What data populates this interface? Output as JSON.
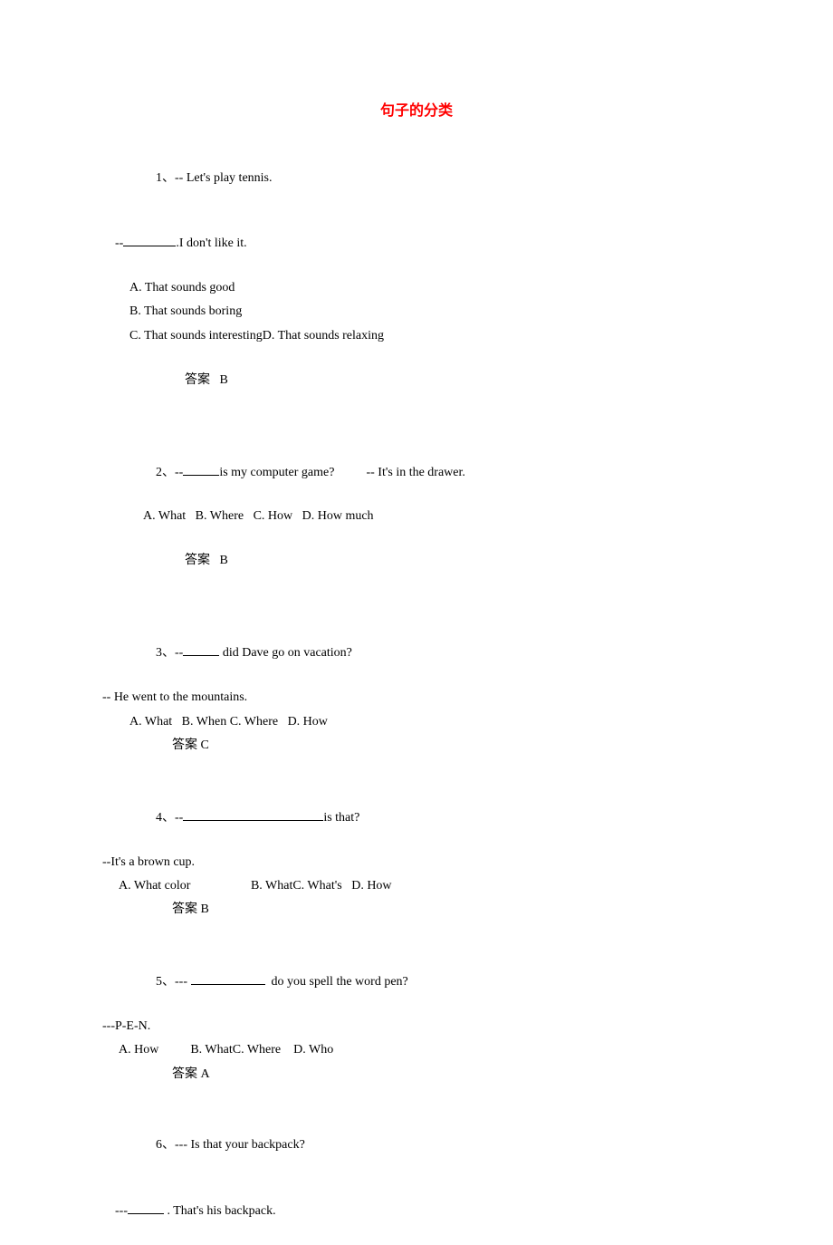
{
  "title": "句子的分类",
  "answer_label": "答案",
  "q1": {
    "num": "1、",
    "prompt": "-- Let's play tennis.",
    "line2_pre": "--",
    "line2_post": ".I don't like it.",
    "optA": "A. That sounds good",
    "optB": "B. That sounds boring",
    "optCD": "C. That sounds interestingD. That sounds relaxing",
    "answer": "B"
  },
  "q2": {
    "num": "2、",
    "line1_pre": "--",
    "line1_mid": "is my computer game?",
    "line1_right": "-- It's in the drawer.",
    "opts": "A. What   B. Where   C. How   D. How much",
    "answer": "B"
  },
  "q3": {
    "num": "3、",
    "line1_pre": "--",
    "line1_post": " did Dave go on vacation?",
    "line2": "-- He went to the mountains.",
    "opts": "A. What   B. When C. Where   D. How",
    "answer": "答案 C"
  },
  "q4": {
    "num": "4、",
    "line1_pre": "--",
    "line1_post": "is that?",
    "line2": "--It's a brown cup.",
    "opts": "A. What color                   B. WhatC. What's   D. How",
    "answer": "答案 B"
  },
  "q5": {
    "num": "5、",
    "line1_pre": "--- ",
    "line1_post": "  do you spell the word pen?",
    "line2": "---P-E-N.",
    "opts": "A. How          B. WhatC. Where    D. Who",
    "answer": "答案 A"
  },
  "q6": {
    "num": "6、",
    "line1": "--- Is that your backpack?",
    "line2_pre": "---",
    "line2_post": " . That's his backpack."
  }
}
